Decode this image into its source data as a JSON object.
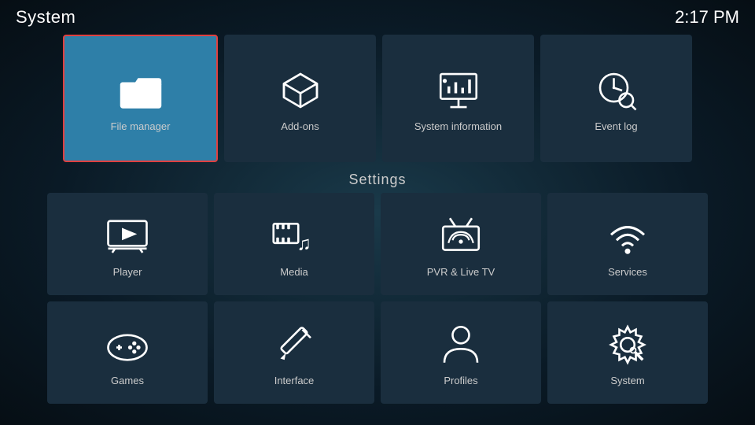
{
  "header": {
    "title": "System",
    "time": "2:17 PM"
  },
  "top_row": {
    "tiles": [
      {
        "id": "file-manager",
        "label": "File manager",
        "selected": true
      },
      {
        "id": "add-ons",
        "label": "Add-ons",
        "selected": false
      },
      {
        "id": "system-information",
        "label": "System information",
        "selected": false
      },
      {
        "id": "event-log",
        "label": "Event log",
        "selected": false
      }
    ]
  },
  "settings_section": {
    "label": "Settings",
    "rows": [
      [
        {
          "id": "player",
          "label": "Player"
        },
        {
          "id": "media",
          "label": "Media"
        },
        {
          "id": "pvr-live-tv",
          "label": "PVR & Live TV"
        },
        {
          "id": "services",
          "label": "Services"
        }
      ],
      [
        {
          "id": "games",
          "label": "Games"
        },
        {
          "id": "interface",
          "label": "Interface"
        },
        {
          "id": "profiles",
          "label": "Profiles"
        },
        {
          "id": "system",
          "label": "System"
        }
      ]
    ]
  }
}
